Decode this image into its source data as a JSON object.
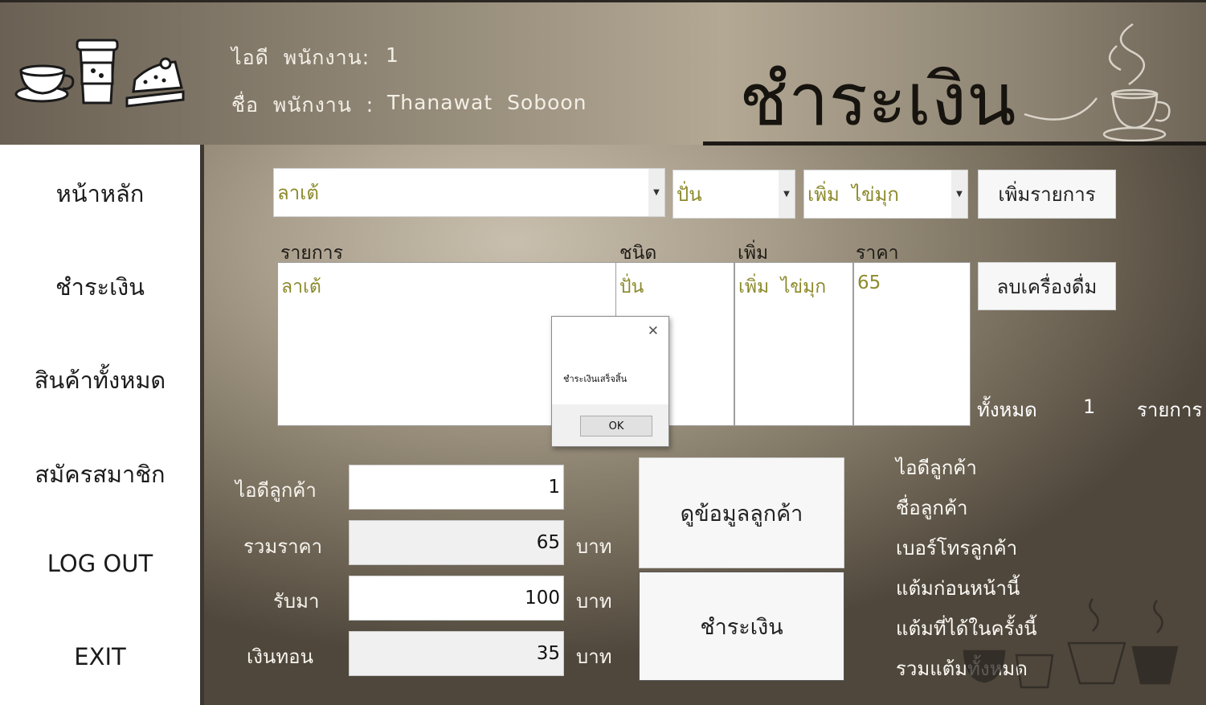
{
  "header": {
    "employee_id_label": "ไอดี  พนักงาน:",
    "employee_id_value": "1",
    "employee_name_label": "ชื่อ  พนักงาน  :",
    "employee_name_value": "Thanawat  Soboon",
    "page_title": "ชำระเงิน"
  },
  "sidebar": {
    "items": [
      {
        "label": "หน้าหลัก"
      },
      {
        "label": "ชำระเงิน"
      },
      {
        "label": "สินค้าทั้งหมด"
      },
      {
        "label": "สมัครสมาชิก"
      },
      {
        "label": "LOG   OUT"
      },
      {
        "label": "EXIT"
      }
    ]
  },
  "order": {
    "drink_select": "ลาเต้",
    "type_select": "ปั่น",
    "topping_select": "เพิ่ม  ไข่มุก",
    "add_button": "เพิ่มรายการ",
    "remove_button": "ลบเครื่องดื่ม",
    "columns": {
      "item": "รายการ",
      "type": "ชนิด",
      "extra": "เพิ่ม",
      "price": "ราคา"
    },
    "rows": [
      {
        "item": "ลาเต้",
        "type": "ปั่น",
        "extra": "เพิ่ม  ไข่มุก",
        "price": "65"
      }
    ],
    "total_label": "ทั้งหมด",
    "total_count": "1",
    "total_unit": "รายการ"
  },
  "payment": {
    "customer_id_label": "ไอดีลูกค้า",
    "customer_id_value": "1",
    "total_price_label": "รวมราคา",
    "total_price_value": "65",
    "received_label": "รับมา",
    "received_value": "100",
    "change_label": "เงินทอน",
    "change_value": "35",
    "currency": "บาท",
    "view_customer_button": "ดูข้อมูลลูกค้า",
    "pay_button": "ชำระเงิน"
  },
  "customer_info": {
    "id_label": "ไอดีลูกค้า",
    "name_label": "ชื่อลูกค้า",
    "phone_label": "เบอร์โทรลูกค้า",
    "points_before_label": "แต้มก่อนหน้านี้",
    "points_earned_label": "แต้มที่ได้ในครั้งนี้",
    "points_total_label": "รวมแต้มทั้งหมด"
  },
  "dialog": {
    "message": "ชำระเงินเสร็จสิ้น",
    "ok_label": "OK",
    "close_symbol": "✕"
  },
  "icons": {
    "logo": "coffee-cup-latte-cake-icon",
    "title_decoration": "steaming-coffee-cup-icon",
    "footer_decoration": "coffee-cups-icon"
  }
}
